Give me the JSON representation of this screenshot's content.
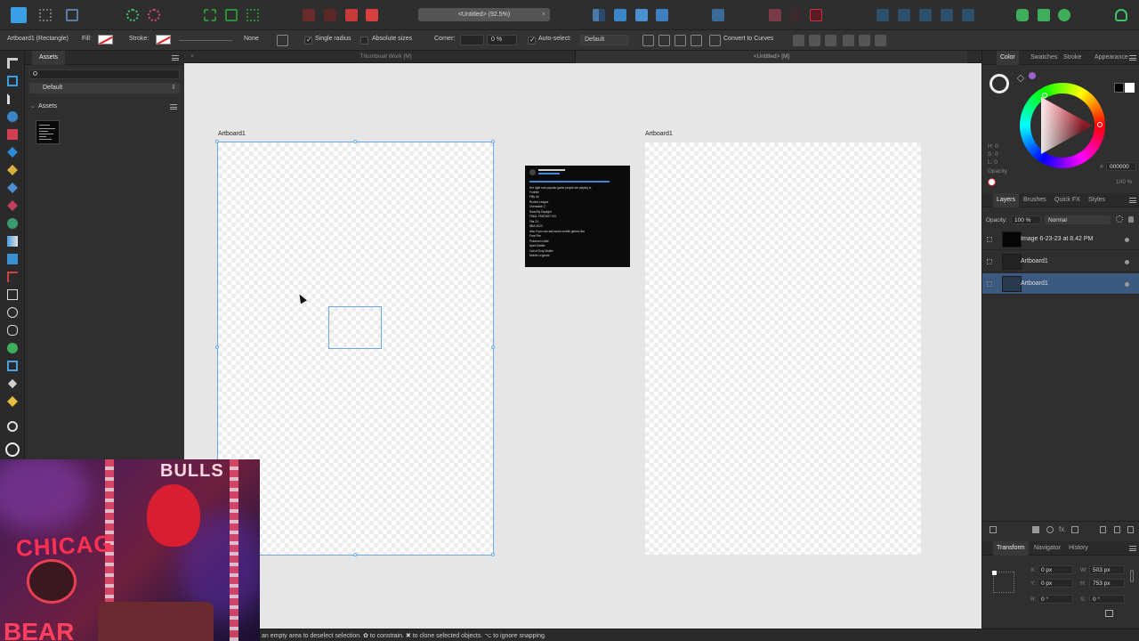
{
  "toolbar": {
    "document_title": "<Untitled> (92.5%)",
    "close_symbol": "×"
  },
  "context": {
    "selection_label": "Artboard1 (Rectangle)",
    "fill_label": "Fill:",
    "stroke_label": "Stroke:",
    "stroke_width": "None",
    "single_radius_label": "Single radius",
    "absolute_sizes_label": "Absolute sizes",
    "corner_label": "Corner:",
    "corner_value": "0 %",
    "auto_select_label": "Auto-select:",
    "auto_select_value": "Default",
    "convert_label": "Convert to Curves"
  },
  "assets": {
    "tab_label": "Assets",
    "category_value": "Default",
    "section_label": "Assets"
  },
  "doc_tabs": {
    "tab1": "Thumbnail Work [M]",
    "tab2": "<Untitled> [M]"
  },
  "canvas": {
    "artboard1_label": "Artboard1",
    "artboard2_label": "Artboard1",
    "tweet_lines": [
      "Hot right now popular game people are playing is",
      "Fortnite",
      "Fifty Up",
      "Rocket League",
      "Overwatch 2",
      "Dead By Daylight",
      "FINAL FANTASY XVI",
      "Fifa 23",
      "NBA 2K23",
      "Also if you can add some mobile games like",
      "Free Fire",
      "Pokemon Unite",
      "Apex Mobile",
      "Call of Duty Mobile",
      "Mobile Legends"
    ]
  },
  "color_panel": {
    "tabs": [
      "Color",
      "Swatches",
      "Stroke",
      "Appearance"
    ],
    "h": "H: 0",
    "s": "S: 0",
    "l": "L: 0",
    "opacity_label": "Opacity",
    "hex_prefix": "#",
    "hex_value": "000000",
    "opacity_value": "100 %"
  },
  "layers_panel": {
    "tabs": [
      "Layers",
      "Brushes",
      "Quick FX",
      "Styles"
    ],
    "opacity_label": "Opacity:",
    "opacity_value": "100 %",
    "blend_mode": "Normal",
    "layers": [
      {
        "name": "Image 6-23-23 at 8.42 PM"
      },
      {
        "name": "Artboard1"
      },
      {
        "name": "Artboard1"
      }
    ]
  },
  "transform_panel": {
    "tabs": [
      "Transform",
      "Navigator",
      "History"
    ],
    "x_label": "X:",
    "x_value": "0 px",
    "y_label": "Y:",
    "y_value": "0 px",
    "w_label": "W:",
    "w_value": "503 px",
    "h_label": "H:",
    "h_value": "753 px",
    "r_label": "R:",
    "r_value": "0 °",
    "s_label": "S:",
    "s_value": "0 °"
  },
  "webcam": {
    "text_chicago": "CHICAG",
    "text_bulls": "BULLS",
    "text_bears": "BEAR"
  },
  "status": {
    "hint": "an empty area to deselect selection. ✿ to constrain. ✖ to clone selected objects. ⌥ to ignore snapping."
  },
  "colors": {
    "accent_blue": "#6aa8e6",
    "selected_row": "#3c5a80",
    "canvas_bg": "#e6e6e6",
    "brand_icon": "#3aa0e6"
  }
}
